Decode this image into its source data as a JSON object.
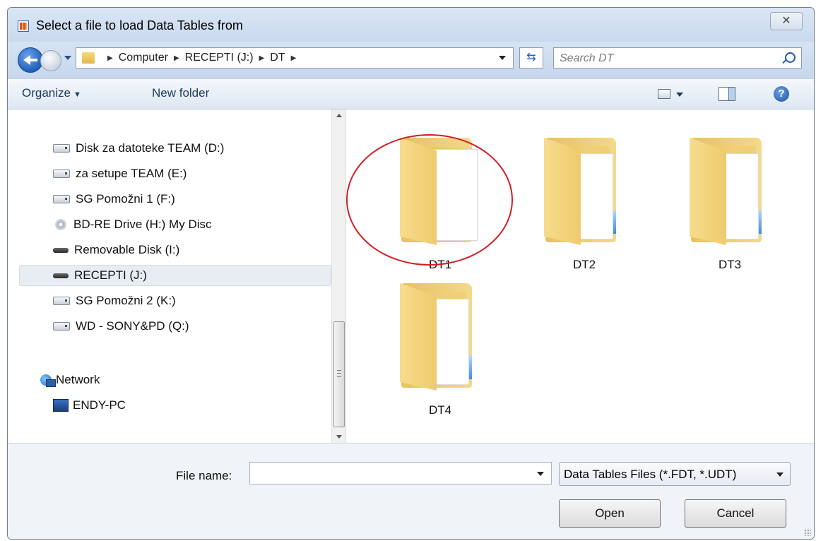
{
  "window": {
    "title": "Select a file to load Data Tables from",
    "close_glyph": "✕"
  },
  "address": {
    "breadcrumbs": [
      "Computer",
      "RECEPTI (J:)",
      "DT"
    ],
    "search_placeholder": "Search DT"
  },
  "toolbar": {
    "organize": "Organize",
    "new_folder": "New folder",
    "help": "?"
  },
  "nav": {
    "items": [
      {
        "label": "Disk za datoteke TEAM (D:)",
        "icon": "drive-icon"
      },
      {
        "label": "za setupe TEAM (E:)",
        "icon": "drive-icon"
      },
      {
        "label": "SG Pomožni 1 (F:)",
        "icon": "drive-icon"
      },
      {
        "label": "BD-RE Drive (H:) My Disc",
        "icon": "disc-icon"
      },
      {
        "label": "Removable Disk (I:)",
        "icon": "removable-drive-icon"
      },
      {
        "label": "RECEPTI (J:)",
        "icon": "removable-drive-icon",
        "selected": true
      },
      {
        "label": "SG Pomožni 2 (K:)",
        "icon": "drive-icon"
      },
      {
        "label": "WD - SONY&PD (Q:)",
        "icon": "drive-icon"
      }
    ],
    "network_label": "Network",
    "computer_label": "ENDY-PC"
  },
  "folders": [
    {
      "label": "DT1"
    },
    {
      "label": "DT2"
    },
    {
      "label": "DT3"
    },
    {
      "label": "DT4"
    }
  ],
  "bottom": {
    "file_name_label": "File name:",
    "file_name_value": "",
    "filter_value": "Data Tables Files (*.FDT, *.UDT)",
    "open_label": "Open",
    "cancel_label": "Cancel"
  },
  "colors": {
    "highlight": "#d21f26",
    "accent": "#1f5fbb"
  }
}
